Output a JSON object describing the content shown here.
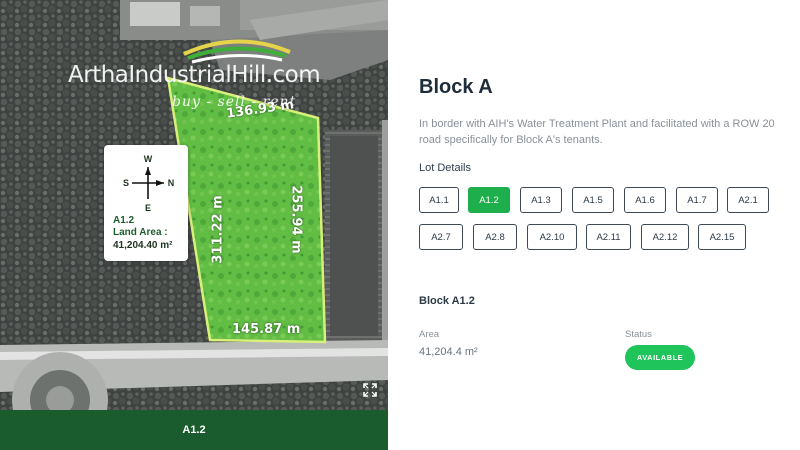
{
  "map": {
    "watermark_title": "ArthaIndustrialHill.com",
    "watermark_subtitle": "buy - sell - rent",
    "dimension_top": "136.93 m",
    "dimension_right": "255.94 m",
    "dimension_left": "311.22 m",
    "dimension_bottom": "145.87 m",
    "compass": {
      "n": "N",
      "s": "S",
      "e": "E",
      "w": "W"
    },
    "card_lot": "A1.2",
    "card_area_label": "Land Area :",
    "card_area_value": "41,204.40 m²",
    "expand_icon": "expand-icon",
    "colors": {
      "lot_fill": "#5fbf3f",
      "lot_border": "#d8f07a"
    }
  },
  "footer": {
    "label": "A1.2",
    "color": "#1b5c2e"
  },
  "detail": {
    "title": "Block A",
    "description": "In border with AIH's Water Treatment Plant and facilitated with a ROW 20 road specifically for Block A's tenants.",
    "lot_details_label": "Lot Details",
    "lots": [
      "A1.1",
      "A1.2",
      "A1.3",
      "A1.5",
      "A1.6",
      "A1.7",
      "A2.1",
      "A2.7",
      "A2.8",
      "A2.10",
      "A2.11",
      "A2.12",
      "A2.15"
    ],
    "selected_lot": "A1.2",
    "selected_title": "Block A1.2",
    "area_label": "Area",
    "area_value": "41,204.4 m²",
    "status_label": "Status",
    "status_value": "AVAILABLE",
    "colors": {
      "accent": "#1fae4c",
      "status": "#1fc45a"
    }
  }
}
